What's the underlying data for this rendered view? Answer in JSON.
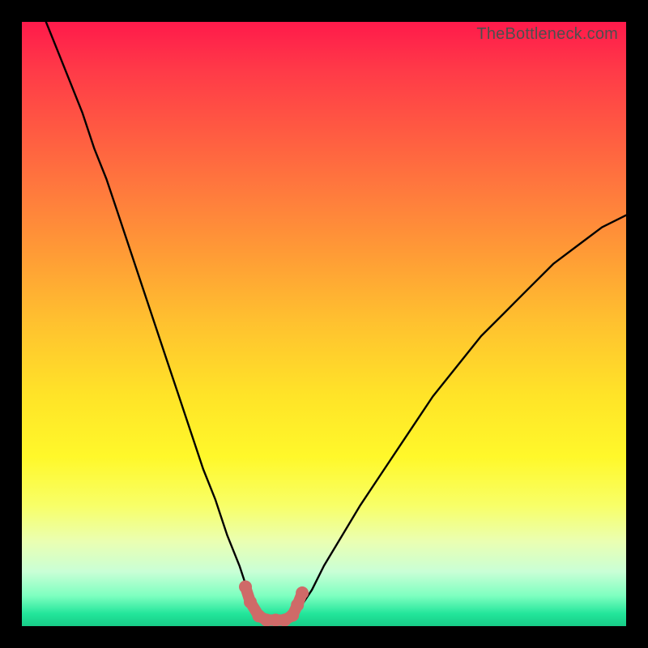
{
  "watermark": "TheBottleneck.com",
  "chart_data": {
    "type": "line",
    "title": "",
    "xlabel": "",
    "ylabel": "",
    "xlim": [
      0,
      100
    ],
    "ylim": [
      0,
      100
    ],
    "series": [
      {
        "name": "bottleneck-curve",
        "x": [
          4,
          6,
          8,
          10,
          12,
          14,
          16,
          18,
          20,
          22,
          24,
          26,
          28,
          30,
          32,
          34,
          36,
          37,
          38,
          39,
          40,
          41,
          42,
          43,
          44,
          45,
          46,
          48,
          50,
          53,
          56,
          60,
          64,
          68,
          72,
          76,
          80,
          84,
          88,
          92,
          96,
          100
        ],
        "values": [
          100,
          95,
          90,
          85,
          79,
          74,
          68,
          62,
          56,
          50,
          44,
          38,
          32,
          26,
          21,
          15,
          10,
          7,
          5,
          3,
          2,
          1.2,
          1,
          1,
          1.2,
          2,
          3,
          6,
          10,
          15,
          20,
          26,
          32,
          38,
          43,
          48,
          52,
          56,
          60,
          63,
          66,
          68
        ]
      }
    ],
    "markers": {
      "name": "optimal-zone",
      "color": "#cf6a68",
      "points": [
        {
          "x": 37.0,
          "y": 6.5
        },
        {
          "x": 37.8,
          "y": 4.0
        },
        {
          "x": 39.2,
          "y": 1.7
        },
        {
          "x": 40.5,
          "y": 1.0
        },
        {
          "x": 42.0,
          "y": 1.0
        },
        {
          "x": 43.5,
          "y": 1.0
        },
        {
          "x": 44.8,
          "y": 1.8
        },
        {
          "x": 45.6,
          "y": 3.5
        },
        {
          "x": 46.4,
          "y": 5.5
        }
      ]
    }
  }
}
